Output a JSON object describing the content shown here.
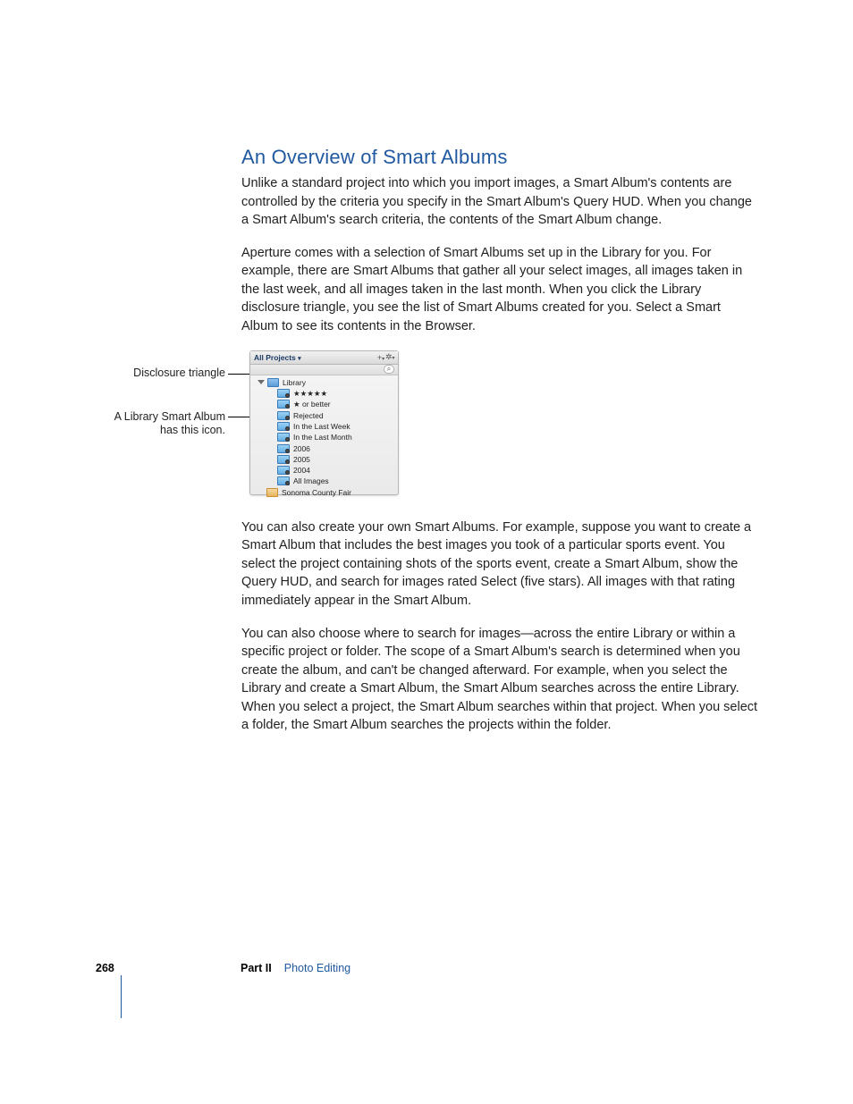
{
  "heading": "An Overview of Smart Albums",
  "para1": "Unlike a standard project into which you import images, a Smart Album's contents are controlled by the criteria you specify in the Smart Album's Query HUD. When you change a Smart Album's search criteria, the contents of the Smart Album change.",
  "para2": "Aperture comes with a selection of Smart Albums set up in the Library for you. For example, there are Smart Albums that gather all your select images, all images taken in the last week, and all images taken in the last month. When you click the Library disclosure triangle, you see the list of Smart Albums created for you. Select a Smart Album to see its contents in the Browser.",
  "para3": "You can also create your own Smart Albums. For example, suppose you want to create a Smart Album that includes the best images you took of a particular sports event. You select the project containing shots of the sports event, create a Smart Album, show the Query HUD, and search for images rated Select (five stars). All images with that rating immediately appear in the Smart Album.",
  "para4": "You can also choose where to search for images—across the entire Library or within a specific project or folder. The scope of a Smart Album's search is determined when you create the album, and can't be changed afterward. For example, when you select the Library and create a Smart Album, the Smart Album searches across the entire Library. When you select a project, the Smart Album searches within that project. When you select a folder, the Smart Album searches the projects within the folder.",
  "callouts": {
    "disclosure": "Disclosure triangle",
    "smart_icon_l1": "A Library Smart Album",
    "smart_icon_l2": "has this icon."
  },
  "panel": {
    "header_title": "All Projects",
    "header_add": "+",
    "header_gear": "✲",
    "search_glyph": "⌕",
    "library_label": "Library",
    "items": [
      "★★★★★",
      "★ or better",
      "Rejected",
      "In the Last Week",
      "In the Last Month",
      "2006",
      "2005",
      "2004",
      "All Images"
    ],
    "project_label": "Sonoma County Fair"
  },
  "footer": {
    "page": "268",
    "part_label": "Part II",
    "part_name": "Photo Editing"
  }
}
